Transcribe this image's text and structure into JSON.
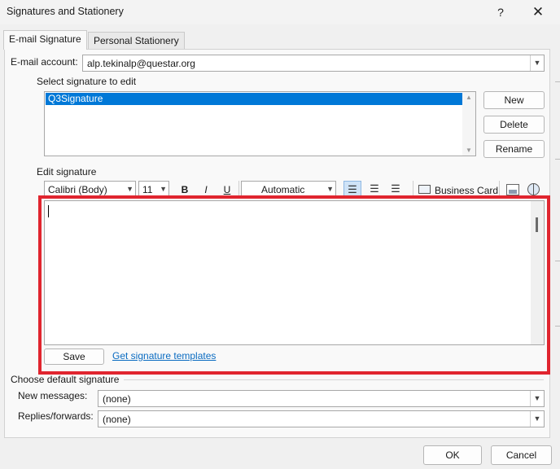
{
  "window": {
    "title": "Signatures and Stationery",
    "help_glyph": "?",
    "close_glyph": "✕"
  },
  "tabs": [
    {
      "label": "E-mail Signature",
      "active": true
    },
    {
      "label": "Personal Stationery",
      "active": false
    }
  ],
  "email_account": {
    "label": "E-mail account:",
    "value": "alp.tekinalp@questar.org"
  },
  "select_signature": {
    "label": "Select signature to edit",
    "items": [
      "Q3Signature"
    ]
  },
  "signature_buttons": {
    "new": "New",
    "delete": "Delete",
    "rename": "Rename"
  },
  "edit_signature": {
    "label": "Edit signature",
    "font": "Calibri (Body)",
    "size": "11",
    "bold": "B",
    "italic": "I",
    "underline": "U",
    "color": "Automatic",
    "business_card": "Business Card",
    "body_text": ""
  },
  "save_label": "Save",
  "templates_link": "Get signature templates",
  "default_signature": {
    "heading": "Choose default signature",
    "new_messages_label": "New messages:",
    "new_messages_value": "(none)",
    "replies_label": "Replies/forwards:",
    "replies_value": "(none)"
  },
  "footer": {
    "ok": "OK",
    "cancel": "Cancel"
  },
  "colors": {
    "accent": "#0078d7",
    "highlight": "#e0252f",
    "link": "#0a6bc1"
  }
}
